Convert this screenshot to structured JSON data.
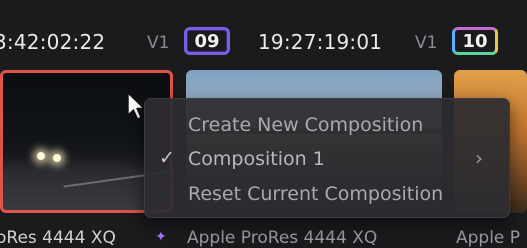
{
  "header": {
    "clips": [
      {
        "timecode": "3:42:02:22",
        "track": "V1",
        "clip_number": "09"
      },
      {
        "timecode": "19:27:19:01",
        "track": "V1",
        "clip_number": "10"
      }
    ]
  },
  "bottom": {
    "codecs": [
      "oRes 4444 XQ",
      "Apple ProRes 4444 XQ",
      "Apple P"
    ]
  },
  "context_menu": {
    "items": [
      {
        "label": "Create New Composition"
      },
      {
        "label": "Composition 1",
        "checked": true,
        "has_submenu": true
      },
      {
        "label": "Reset Current Composition"
      }
    ]
  },
  "icons": {
    "check": "checkmark-icon",
    "submenu": "chevron-right-icon",
    "cursor": "pointer-cursor-icon",
    "sparkle": "sparkle-icon"
  },
  "colors": {
    "selected_border": "#e0534a",
    "menu_bg": "#2c2c30",
    "menu_text": "#a9a9ae"
  }
}
